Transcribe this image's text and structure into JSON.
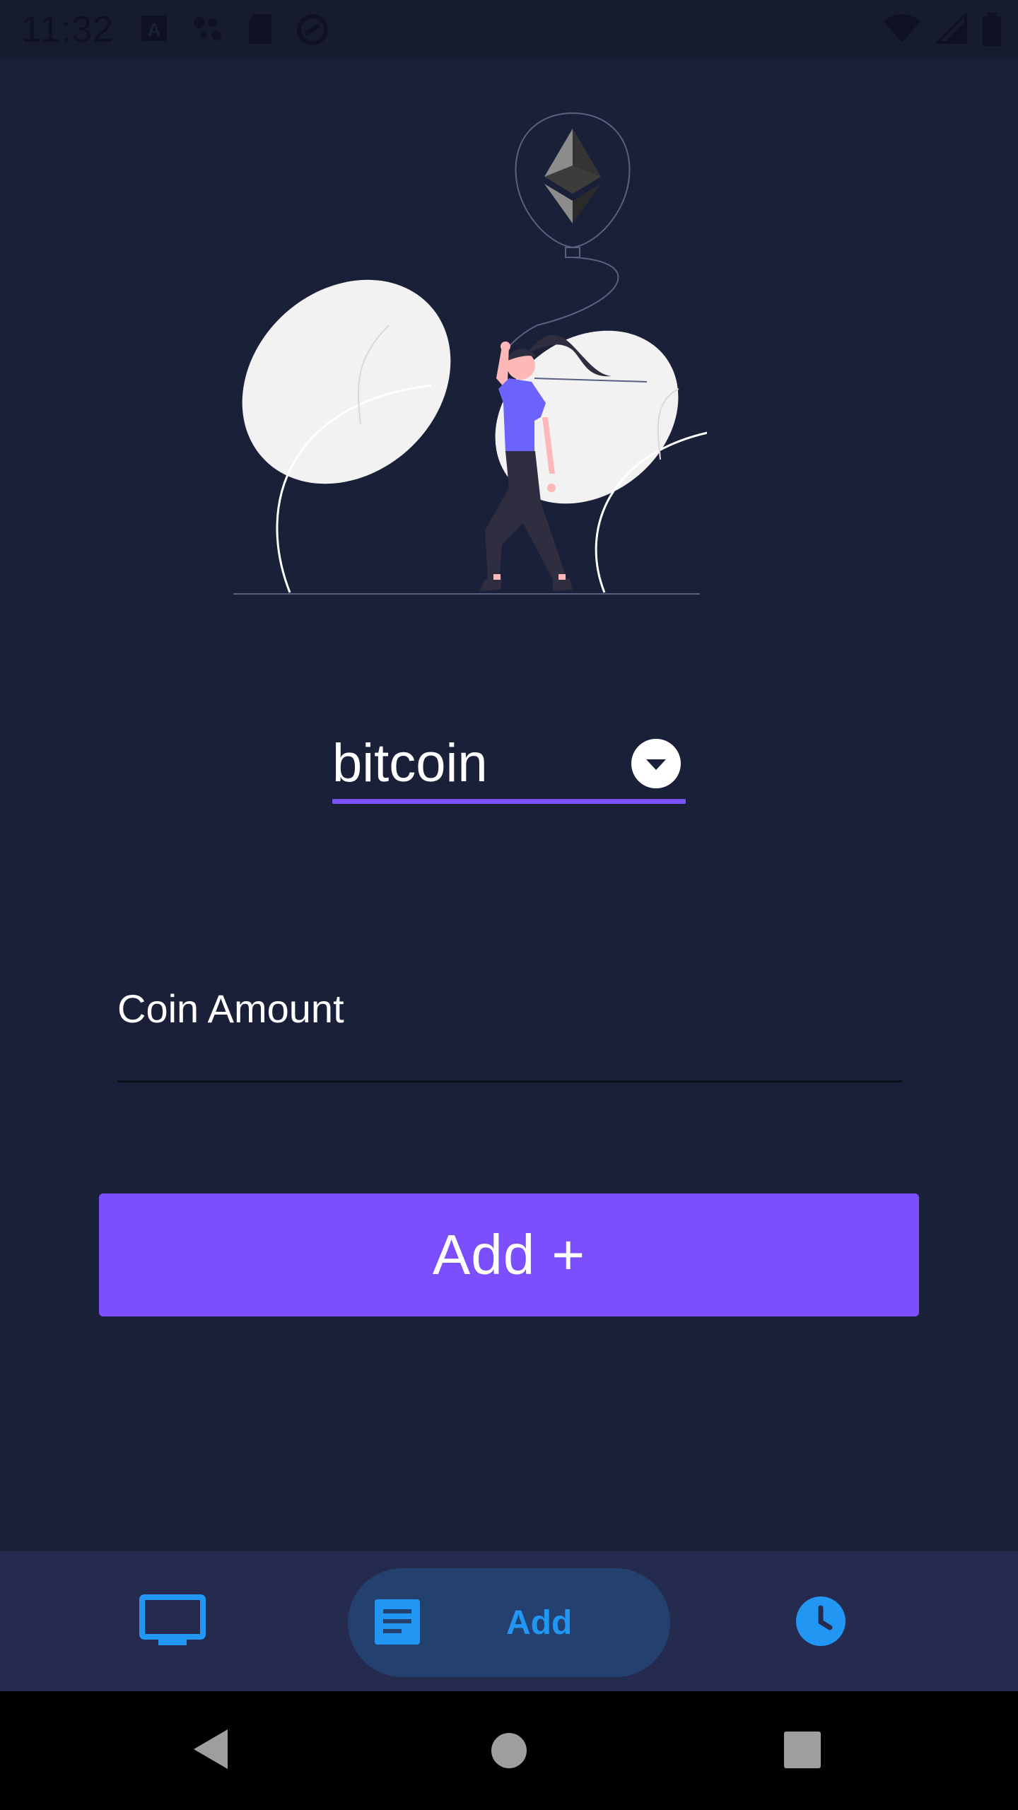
{
  "status_bar": {
    "time": "11:32",
    "icons": [
      "keyboard-a-icon",
      "assistant-dots-icon",
      "sd-card-icon",
      "sync-icon",
      "wifi-icon",
      "cell-signal-icon",
      "battery-icon"
    ]
  },
  "illustration": {
    "description_icon": "ethereum-balloon-illustration",
    "colors": {
      "leaf": "#f2f2f2",
      "shirt": "#6c63ff",
      "skin": "#ffb8b8",
      "hair": "#2f2e41"
    }
  },
  "coin_select": {
    "selected": "bitcoin"
  },
  "amount_field": {
    "placeholder": "Coin Amount",
    "value": ""
  },
  "add_button": {
    "label": "Add +"
  },
  "bottom_nav": {
    "items": [
      {
        "icon": "monitor-icon",
        "label": ""
      },
      {
        "icon": "document-icon",
        "label": "Add",
        "active": true
      },
      {
        "icon": "clock-icon",
        "label": ""
      }
    ]
  },
  "system_nav": {
    "icons": [
      "back-icon",
      "home-icon",
      "recents-icon"
    ]
  },
  "colors": {
    "background": "#1b2039",
    "accent": "#7c4ffe",
    "nav_background": "#242b4f",
    "nav_active_pill": "#24406f",
    "nav_icon": "#2196f3"
  }
}
